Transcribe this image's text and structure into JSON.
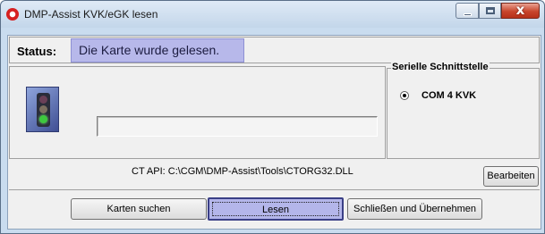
{
  "window": {
    "title": "DMP-Assist KVK/eGK lesen",
    "controls": {
      "close_glyph": "x"
    }
  },
  "status": {
    "label": "Status:",
    "value": "Die Karte wurde gelesen."
  },
  "indicator": {
    "icon": "traffic-light-icon",
    "active_light": "green",
    "progress": 0
  },
  "serial": {
    "group_title": "Serielle Schnittstelle",
    "options": [
      {
        "label": "COM 4 KVK",
        "selected": true
      }
    ]
  },
  "ctapi": {
    "text": "CT API: C:\\CGM\\DMP-Assist\\Tools\\CTORG32.DLL",
    "edit_label": "Bearbeiten"
  },
  "buttons": {
    "search_label": "Karten suchen",
    "read_label": "Lesen",
    "close_apply_label": "Schließen und Übernehmen"
  },
  "colors": {
    "status_highlight": "#b7b8ea",
    "window_frame": "#c9dcef",
    "close_button": "#c8452c"
  }
}
